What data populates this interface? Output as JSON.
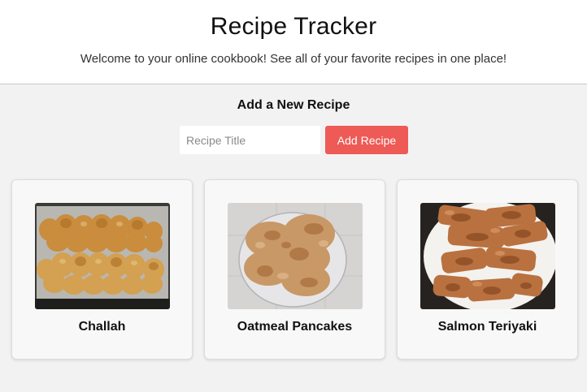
{
  "header": {
    "title": "Recipe Tracker",
    "subtitle": "Welcome to your online cookbook! See all of your favorite recipes in one place!"
  },
  "add_recipe": {
    "heading": "Add a New Recipe",
    "input_placeholder": "Recipe Title",
    "input_value": "",
    "button_label": "Add Recipe"
  },
  "recipes": [
    {
      "title": "Challah",
      "image": "braided-challah-bread-photo"
    },
    {
      "title": "Oatmeal Pancakes",
      "image": "oatmeal-pancakes-on-plate-photo"
    },
    {
      "title": "Salmon Teriyaki",
      "image": "salmon-teriyaki-on-plate-photo"
    }
  ],
  "colors": {
    "accent_button": "#ee5a56",
    "page_background": "#f2f2f2",
    "header_background": "#ffffff",
    "card_background": "#f8f8f8"
  }
}
